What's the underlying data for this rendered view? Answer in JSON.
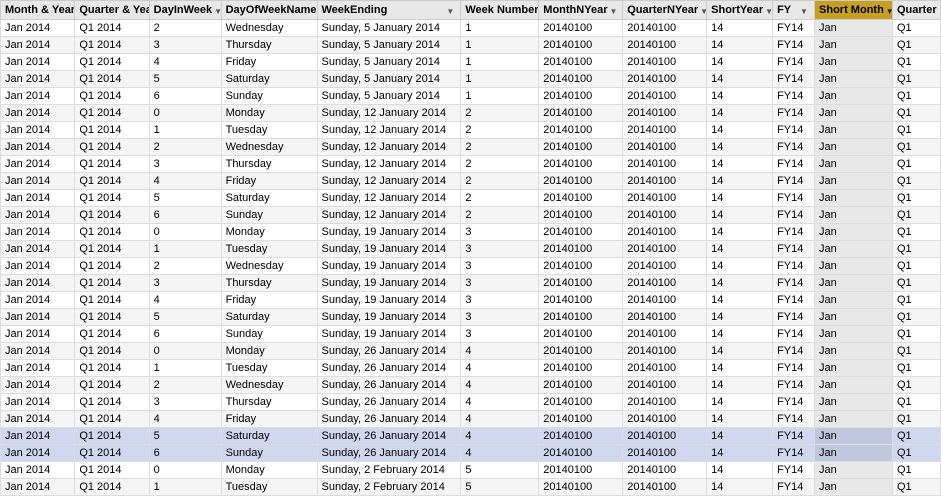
{
  "columns": [
    {
      "id": "month",
      "label": "Month & Year",
      "class": "col-month",
      "active": false
    },
    {
      "id": "quarter",
      "label": "Quarter & Year",
      "class": "col-quarter",
      "active": false
    },
    {
      "id": "dayinweek",
      "label": "DayInWeek",
      "class": "col-dayinweek",
      "active": false
    },
    {
      "id": "dayofweekname",
      "label": "DayOfWeekName",
      "class": "col-dayofweekname",
      "active": false
    },
    {
      "id": "weekending",
      "label": "WeekEnding",
      "class": "col-weekending",
      "active": false
    },
    {
      "id": "weeknumber",
      "label": "Week Number",
      "class": "col-weeknumber",
      "active": false
    },
    {
      "id": "monthyear",
      "label": "MonthNYear",
      "class": "col-monthyear",
      "active": false
    },
    {
      "id": "quarteryear",
      "label": "QuarterNYear",
      "class": "col-quarteryear",
      "active": false
    },
    {
      "id": "shortyear",
      "label": "ShortYear",
      "class": "col-shortyear",
      "active": false
    },
    {
      "id": "fy",
      "label": "FY",
      "class": "col-fy",
      "active": false
    },
    {
      "id": "shortmonth",
      "label": "Short Month",
      "class": "col-shortmonth",
      "active": true
    },
    {
      "id": "quarterx",
      "label": "Quarter",
      "class": "col-quarterx",
      "active": false
    }
  ],
  "rows": [
    {
      "month": "Jan 2014",
      "quarter": "Q1 2014",
      "dayinweek": "2",
      "dayofweekname": "Wednesday",
      "weekending": "Sunday, 5 January 2014",
      "weeknumber": "1",
      "monthyear": "20140100",
      "quarteryear": "20140100",
      "shortyear": "14",
      "fy": "FY14",
      "shortmonth": "Jan",
      "quarterx": "Q1",
      "highlighted": false
    },
    {
      "month": "Jan 2014",
      "quarter": "Q1 2014",
      "dayinweek": "3",
      "dayofweekname": "Thursday",
      "weekending": "Sunday, 5 January 2014",
      "weeknumber": "1",
      "monthyear": "20140100",
      "quarteryear": "20140100",
      "shortyear": "14",
      "fy": "FY14",
      "shortmonth": "Jan",
      "quarterx": "Q1",
      "highlighted": false
    },
    {
      "month": "Jan 2014",
      "quarter": "Q1 2014",
      "dayinweek": "4",
      "dayofweekname": "Friday",
      "weekending": "Sunday, 5 January 2014",
      "weeknumber": "1",
      "monthyear": "20140100",
      "quarteryear": "20140100",
      "shortyear": "14",
      "fy": "FY14",
      "shortmonth": "Jan",
      "quarterx": "Q1",
      "highlighted": false
    },
    {
      "month": "Jan 2014",
      "quarter": "Q1 2014",
      "dayinweek": "5",
      "dayofweekname": "Saturday",
      "weekending": "Sunday, 5 January 2014",
      "weeknumber": "1",
      "monthyear": "20140100",
      "quarteryear": "20140100",
      "shortyear": "14",
      "fy": "FY14",
      "shortmonth": "Jan",
      "quarterx": "Q1",
      "highlighted": false
    },
    {
      "month": "Jan 2014",
      "quarter": "Q1 2014",
      "dayinweek": "6",
      "dayofweekname": "Sunday",
      "weekending": "Sunday, 5 January 2014",
      "weeknumber": "1",
      "monthyear": "20140100",
      "quarteryear": "20140100",
      "shortyear": "14",
      "fy": "FY14",
      "shortmonth": "Jan",
      "quarterx": "Q1",
      "highlighted": false
    },
    {
      "month": "Jan 2014",
      "quarter": "Q1 2014",
      "dayinweek": "0",
      "dayofweekname": "Monday",
      "weekending": "Sunday, 12 January 2014",
      "weeknumber": "2",
      "monthyear": "20140100",
      "quarteryear": "20140100",
      "shortyear": "14",
      "fy": "FY14",
      "shortmonth": "Jan",
      "quarterx": "Q1",
      "highlighted": false
    },
    {
      "month": "Jan 2014",
      "quarter": "Q1 2014",
      "dayinweek": "1",
      "dayofweekname": "Tuesday",
      "weekending": "Sunday, 12 January 2014",
      "weeknumber": "2",
      "monthyear": "20140100",
      "quarteryear": "20140100",
      "shortyear": "14",
      "fy": "FY14",
      "shortmonth": "Jan",
      "quarterx": "Q1",
      "highlighted": false
    },
    {
      "month": "Jan 2014",
      "quarter": "Q1 2014",
      "dayinweek": "2",
      "dayofweekname": "Wednesday",
      "weekending": "Sunday, 12 January 2014",
      "weeknumber": "2",
      "monthyear": "20140100",
      "quarteryear": "20140100",
      "shortyear": "14",
      "fy": "FY14",
      "shortmonth": "Jan",
      "quarterx": "Q1",
      "highlighted": false
    },
    {
      "month": "Jan 2014",
      "quarter": "Q1 2014",
      "dayinweek": "3",
      "dayofweekname": "Thursday",
      "weekending": "Sunday, 12 January 2014",
      "weeknumber": "2",
      "monthyear": "20140100",
      "quarteryear": "20140100",
      "shortyear": "14",
      "fy": "FY14",
      "shortmonth": "Jan",
      "quarterx": "Q1",
      "highlighted": false
    },
    {
      "month": "Jan 2014",
      "quarter": "Q1 2014",
      "dayinweek": "4",
      "dayofweekname": "Friday",
      "weekending": "Sunday, 12 January 2014",
      "weeknumber": "2",
      "monthyear": "20140100",
      "quarteryear": "20140100",
      "shortyear": "14",
      "fy": "FY14",
      "shortmonth": "Jan",
      "quarterx": "Q1",
      "highlighted": false
    },
    {
      "month": "Jan 2014",
      "quarter": "Q1 2014",
      "dayinweek": "5",
      "dayofweekname": "Saturday",
      "weekending": "Sunday, 12 January 2014",
      "weeknumber": "2",
      "monthyear": "20140100",
      "quarteryear": "20140100",
      "shortyear": "14",
      "fy": "FY14",
      "shortmonth": "Jan",
      "quarterx": "Q1",
      "highlighted": false
    },
    {
      "month": "Jan 2014",
      "quarter": "Q1 2014",
      "dayinweek": "6",
      "dayofweekname": "Sunday",
      "weekending": "Sunday, 12 January 2014",
      "weeknumber": "2",
      "monthyear": "20140100",
      "quarteryear": "20140100",
      "shortyear": "14",
      "fy": "FY14",
      "shortmonth": "Jan",
      "quarterx": "Q1",
      "highlighted": false
    },
    {
      "month": "Jan 2014",
      "quarter": "Q1 2014",
      "dayinweek": "0",
      "dayofweekname": "Monday",
      "weekending": "Sunday, 19 January 2014",
      "weeknumber": "3",
      "monthyear": "20140100",
      "quarteryear": "20140100",
      "shortyear": "14",
      "fy": "FY14",
      "shortmonth": "Jan",
      "quarterx": "Q1",
      "highlighted": false
    },
    {
      "month": "Jan 2014",
      "quarter": "Q1 2014",
      "dayinweek": "1",
      "dayofweekname": "Tuesday",
      "weekending": "Sunday, 19 January 2014",
      "weeknumber": "3",
      "monthyear": "20140100",
      "quarteryear": "20140100",
      "shortyear": "14",
      "fy": "FY14",
      "shortmonth": "Jan",
      "quarterx": "Q1",
      "highlighted": false
    },
    {
      "month": "Jan 2014",
      "quarter": "Q1 2014",
      "dayinweek": "2",
      "dayofweekname": "Wednesday",
      "weekending": "Sunday, 19 January 2014",
      "weeknumber": "3",
      "monthyear": "20140100",
      "quarteryear": "20140100",
      "shortyear": "14",
      "fy": "FY14",
      "shortmonth": "Jan",
      "quarterx": "Q1",
      "highlighted": false
    },
    {
      "month": "Jan 2014",
      "quarter": "Q1 2014",
      "dayinweek": "3",
      "dayofweekname": "Thursday",
      "weekending": "Sunday, 19 January 2014",
      "weeknumber": "3",
      "monthyear": "20140100",
      "quarteryear": "20140100",
      "shortyear": "14",
      "fy": "FY14",
      "shortmonth": "Jan",
      "quarterx": "Q1",
      "highlighted": false
    },
    {
      "month": "Jan 2014",
      "quarter": "Q1 2014",
      "dayinweek": "4",
      "dayofweekname": "Friday",
      "weekending": "Sunday, 19 January 2014",
      "weeknumber": "3",
      "monthyear": "20140100",
      "quarteryear": "20140100",
      "shortyear": "14",
      "fy": "FY14",
      "shortmonth": "Jan",
      "quarterx": "Q1",
      "highlighted": false
    },
    {
      "month": "Jan 2014",
      "quarter": "Q1 2014",
      "dayinweek": "5",
      "dayofweekname": "Saturday",
      "weekending": "Sunday, 19 January 2014",
      "weeknumber": "3",
      "monthyear": "20140100",
      "quarteryear": "20140100",
      "shortyear": "14",
      "fy": "FY14",
      "shortmonth": "Jan",
      "quarterx": "Q1",
      "highlighted": false
    },
    {
      "month": "Jan 2014",
      "quarter": "Q1 2014",
      "dayinweek": "6",
      "dayofweekname": "Sunday",
      "weekending": "Sunday, 19 January 2014",
      "weeknumber": "3",
      "monthyear": "20140100",
      "quarteryear": "20140100",
      "shortyear": "14",
      "fy": "FY14",
      "shortmonth": "Jan",
      "quarterx": "Q1",
      "highlighted": false
    },
    {
      "month": "Jan 2014",
      "quarter": "Q1 2014",
      "dayinweek": "0",
      "dayofweekname": "Monday",
      "weekending": "Sunday, 26 January 2014",
      "weeknumber": "4",
      "monthyear": "20140100",
      "quarteryear": "20140100",
      "shortyear": "14",
      "fy": "FY14",
      "shortmonth": "Jan",
      "quarterx": "Q1",
      "highlighted": false
    },
    {
      "month": "Jan 2014",
      "quarter": "Q1 2014",
      "dayinweek": "1",
      "dayofweekname": "Tuesday",
      "weekending": "Sunday, 26 January 2014",
      "weeknumber": "4",
      "monthyear": "20140100",
      "quarteryear": "20140100",
      "shortyear": "14",
      "fy": "FY14",
      "shortmonth": "Jan",
      "quarterx": "Q1",
      "highlighted": false
    },
    {
      "month": "Jan 2014",
      "quarter": "Q1 2014",
      "dayinweek": "2",
      "dayofweekname": "Wednesday",
      "weekending": "Sunday, 26 January 2014",
      "weeknumber": "4",
      "monthyear": "20140100",
      "quarteryear": "20140100",
      "shortyear": "14",
      "fy": "FY14",
      "shortmonth": "Jan",
      "quarterx": "Q1",
      "highlighted": false
    },
    {
      "month": "Jan 2014",
      "quarter": "Q1 2014",
      "dayinweek": "3",
      "dayofweekname": "Thursday",
      "weekending": "Sunday, 26 January 2014",
      "weeknumber": "4",
      "monthyear": "20140100",
      "quarteryear": "20140100",
      "shortyear": "14",
      "fy": "FY14",
      "shortmonth": "Jan",
      "quarterx": "Q1",
      "highlighted": false
    },
    {
      "month": "Jan 2014",
      "quarter": "Q1 2014",
      "dayinweek": "4",
      "dayofweekname": "Friday",
      "weekending": "Sunday, 26 January 2014",
      "weeknumber": "4",
      "monthyear": "20140100",
      "quarteryear": "20140100",
      "shortyear": "14",
      "fy": "FY14",
      "shortmonth": "Jan",
      "quarterx": "Q1",
      "highlighted": false
    },
    {
      "month": "Jan 2014",
      "quarter": "Q1 2014",
      "dayinweek": "5",
      "dayofweekname": "Saturday",
      "weekending": "Sunday, 26 January 2014",
      "weeknumber": "4",
      "monthyear": "20140100",
      "quarteryear": "20140100",
      "shortyear": "14",
      "fy": "FY14",
      "shortmonth": "Jan",
      "quarterx": "Q1",
      "highlighted": true
    },
    {
      "month": "Jan 2014",
      "quarter": "Q1 2014",
      "dayinweek": "6",
      "dayofweekname": "Sunday",
      "weekending": "Sunday, 26 January 2014",
      "weeknumber": "4",
      "monthyear": "20140100",
      "quarteryear": "20140100",
      "shortyear": "14",
      "fy": "FY14",
      "shortmonth": "Jan",
      "quarterx": "Q1",
      "highlighted": true
    },
    {
      "month": "Jan 2014",
      "quarter": "Q1 2014",
      "dayinweek": "0",
      "dayofweekname": "Monday",
      "weekending": "Sunday, 2 February 2014",
      "weeknumber": "5",
      "monthyear": "20140100",
      "quarteryear": "20140100",
      "shortyear": "14",
      "fy": "FY14",
      "shortmonth": "Jan",
      "quarterx": "Q1",
      "highlighted": false
    },
    {
      "month": "Jan 2014",
      "quarter": "Q1 2014",
      "dayinweek": "1",
      "dayofweekname": "Tuesday",
      "weekending": "Sunday, 2 February 2014",
      "weeknumber": "5",
      "monthyear": "20140100",
      "quarteryear": "20140100",
      "shortyear": "14",
      "fy": "FY14",
      "shortmonth": "Jan",
      "quarterx": "Q1",
      "highlighted": false
    }
  ]
}
